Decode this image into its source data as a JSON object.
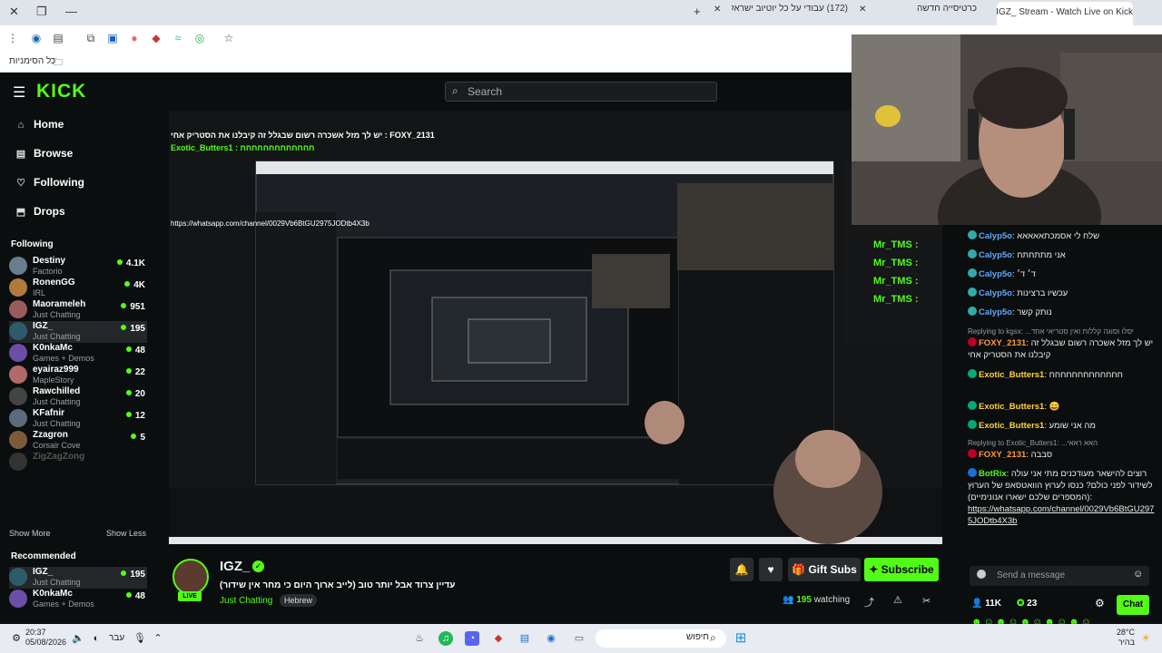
{
  "browser": {
    "tabs": [
      {
        "label": "כרטיסייה חדשה"
      },
      {
        "label": "(172) עבודי על כל יוטיוב ישראל"
      },
      {
        "label": "IGZ_ Stream - Watch Live on Kick"
      }
    ],
    "bookmarks_label": "כל הסימניות"
  },
  "kick": {
    "logo": "KICK",
    "search_placeholder": "Search",
    "nav": [
      {
        "label": "Home",
        "icon": "home-icon",
        "glyph": "⌂"
      },
      {
        "label": "Browse",
        "icon": "browse-icon",
        "glyph": "▤"
      },
      {
        "label": "Following",
        "icon": "heart-icon",
        "glyph": "♡"
      },
      {
        "label": "Drops",
        "icon": "drops-icon",
        "glyph": "⬒"
      }
    ],
    "following_heading": "Following",
    "following": [
      {
        "name": "Destiny",
        "category": "Factorio",
        "viewers": "4.1K",
        "color": "#6a7d8f"
      },
      {
        "name": "RonenGG",
        "category": "IRL",
        "viewers": "4K",
        "color": "#b07a3a"
      },
      {
        "name": "Maorameleh",
        "category": "Just Chatting",
        "viewers": "951",
        "color": "#9a5b5b"
      },
      {
        "name": "IGZ_",
        "category": "Just Chatting",
        "viewers": "195",
        "color": "#2e5b6b"
      },
      {
        "name": "K0nkaMc",
        "category": "Games + Demos",
        "viewers": "48",
        "color": "#6b4ea8"
      },
      {
        "name": "eyairaz999",
        "category": "MapleStory",
        "viewers": "22",
        "color": "#b06a6a"
      },
      {
        "name": "Rawchilled",
        "category": "Just Chatting",
        "viewers": "20",
        "color": "#444"
      },
      {
        "name": "KFafnir",
        "category": "Just Chatting",
        "viewers": "12",
        "color": "#5b6b7b"
      },
      {
        "name": "Zzagron",
        "category": "Corsair Cove",
        "viewers": "5",
        "color": "#7b5b3b"
      },
      {
        "name": "ZigZagZong",
        "category": "",
        "viewers": "",
        "color": "#333"
      }
    ],
    "show_more": "Show More",
    "show_less": "Show Less",
    "recommended_heading": "Recommended",
    "recommended": [
      {
        "name": "IGZ_",
        "category": "Just Chatting",
        "viewers": "195",
        "color": "#2e5b6b"
      },
      {
        "name": "K0nkaMc",
        "category": "Games + Demos",
        "viewers": "48",
        "color": "#6b4ea8"
      }
    ],
    "stream": {
      "channel": "IGZ_",
      "live_badge": "LIVE",
      "title": "עדיין צרוד אבל יותר טוב (לייב ארוך היום כי מחר אין שידור)",
      "category": "Just Chatting",
      "tag": "Hebrew",
      "watching_count": "195",
      "watching_label": "watching",
      "gift_subs": "Gift Subs",
      "subscribe": "Subscribe"
    },
    "chat": {
      "messages": [
        {
          "user": "Calyp5o",
          "text": ": שלח לי אסמכתאאאאא",
          "color": "#5fa8ff"
        },
        {
          "user": "Calyp5o",
          "text": ": אני מתתחתח",
          "color": "#5fa8ff"
        },
        {
          "user": "Calyp5o",
          "text": ": ד׳ ד׳",
          "color": "#5fa8ff"
        },
        {
          "user": "Calyp5o",
          "text": ": עכשיו ברצינות",
          "color": "#5fa8ff"
        },
        {
          "user": "Calyp5o",
          "text": ": נותק קשר",
          "color": "#5fa8ff"
        }
      ],
      "reply1": "Replying to kgsx: ...יסלו וסוגה קללות ואין סטריאי אחד",
      "foxy1_user": "FOXY_2131",
      "foxy1_text": ": יש לך מזל אשכרה רשום שבגלל זה קיבלנו את הסטריק אחי",
      "exotic1_user": "Exotic_Butters1",
      "exotic1_text": ": חחחחחחחחחחחחח",
      "exotic2_user": "Exotic_Butters1",
      "exotic2_text": ":",
      "exotic3_user": "Exotic_Butters1",
      "exotic3_text": ": מה אני שומע",
      "reply2": "Replying to Exotic_Butters1: ...האא ראאי",
      "foxy2_user": "FOXY_2131",
      "foxy2_text": ": סבבה",
      "botrix_user": "BotRix",
      "botrix_text": ": רוצים להישאר מעודכנים מתי אני עולה לשידור לפני כולם? כנסו לערוץ הוואטסאפ של הערוץ (המספרים שלכם ישארו אנונימיים):",
      "botrix_link": "https://whatsapp.com/channel/0029Vb6BtGU2975JODtb4X3b",
      "send_placeholder": "Send a message",
      "followers": "11K",
      "points": "23",
      "chat_button": "Chat"
    }
  },
  "overlay": {
    "mr_tms": "Mr_TMS :",
    "top_foxy": "FOXY_2131 : יש לך מזל אשכרה רשום שבגלל זה קיבלנו את הסטריק אחי",
    "top_exotic": "Exotic_Butters1 : חחחחחחחחחחחחח",
    "top_link": "https://whatsapp.com/channel/0029Vb6BtGU2975JODtb4X3b"
  },
  "taskbar": {
    "time": "20:37",
    "date": "05/08/2026",
    "lang": "עבר",
    "search": "חיפוש",
    "weather": "28°C",
    "weather_sub": "בהיר"
  }
}
